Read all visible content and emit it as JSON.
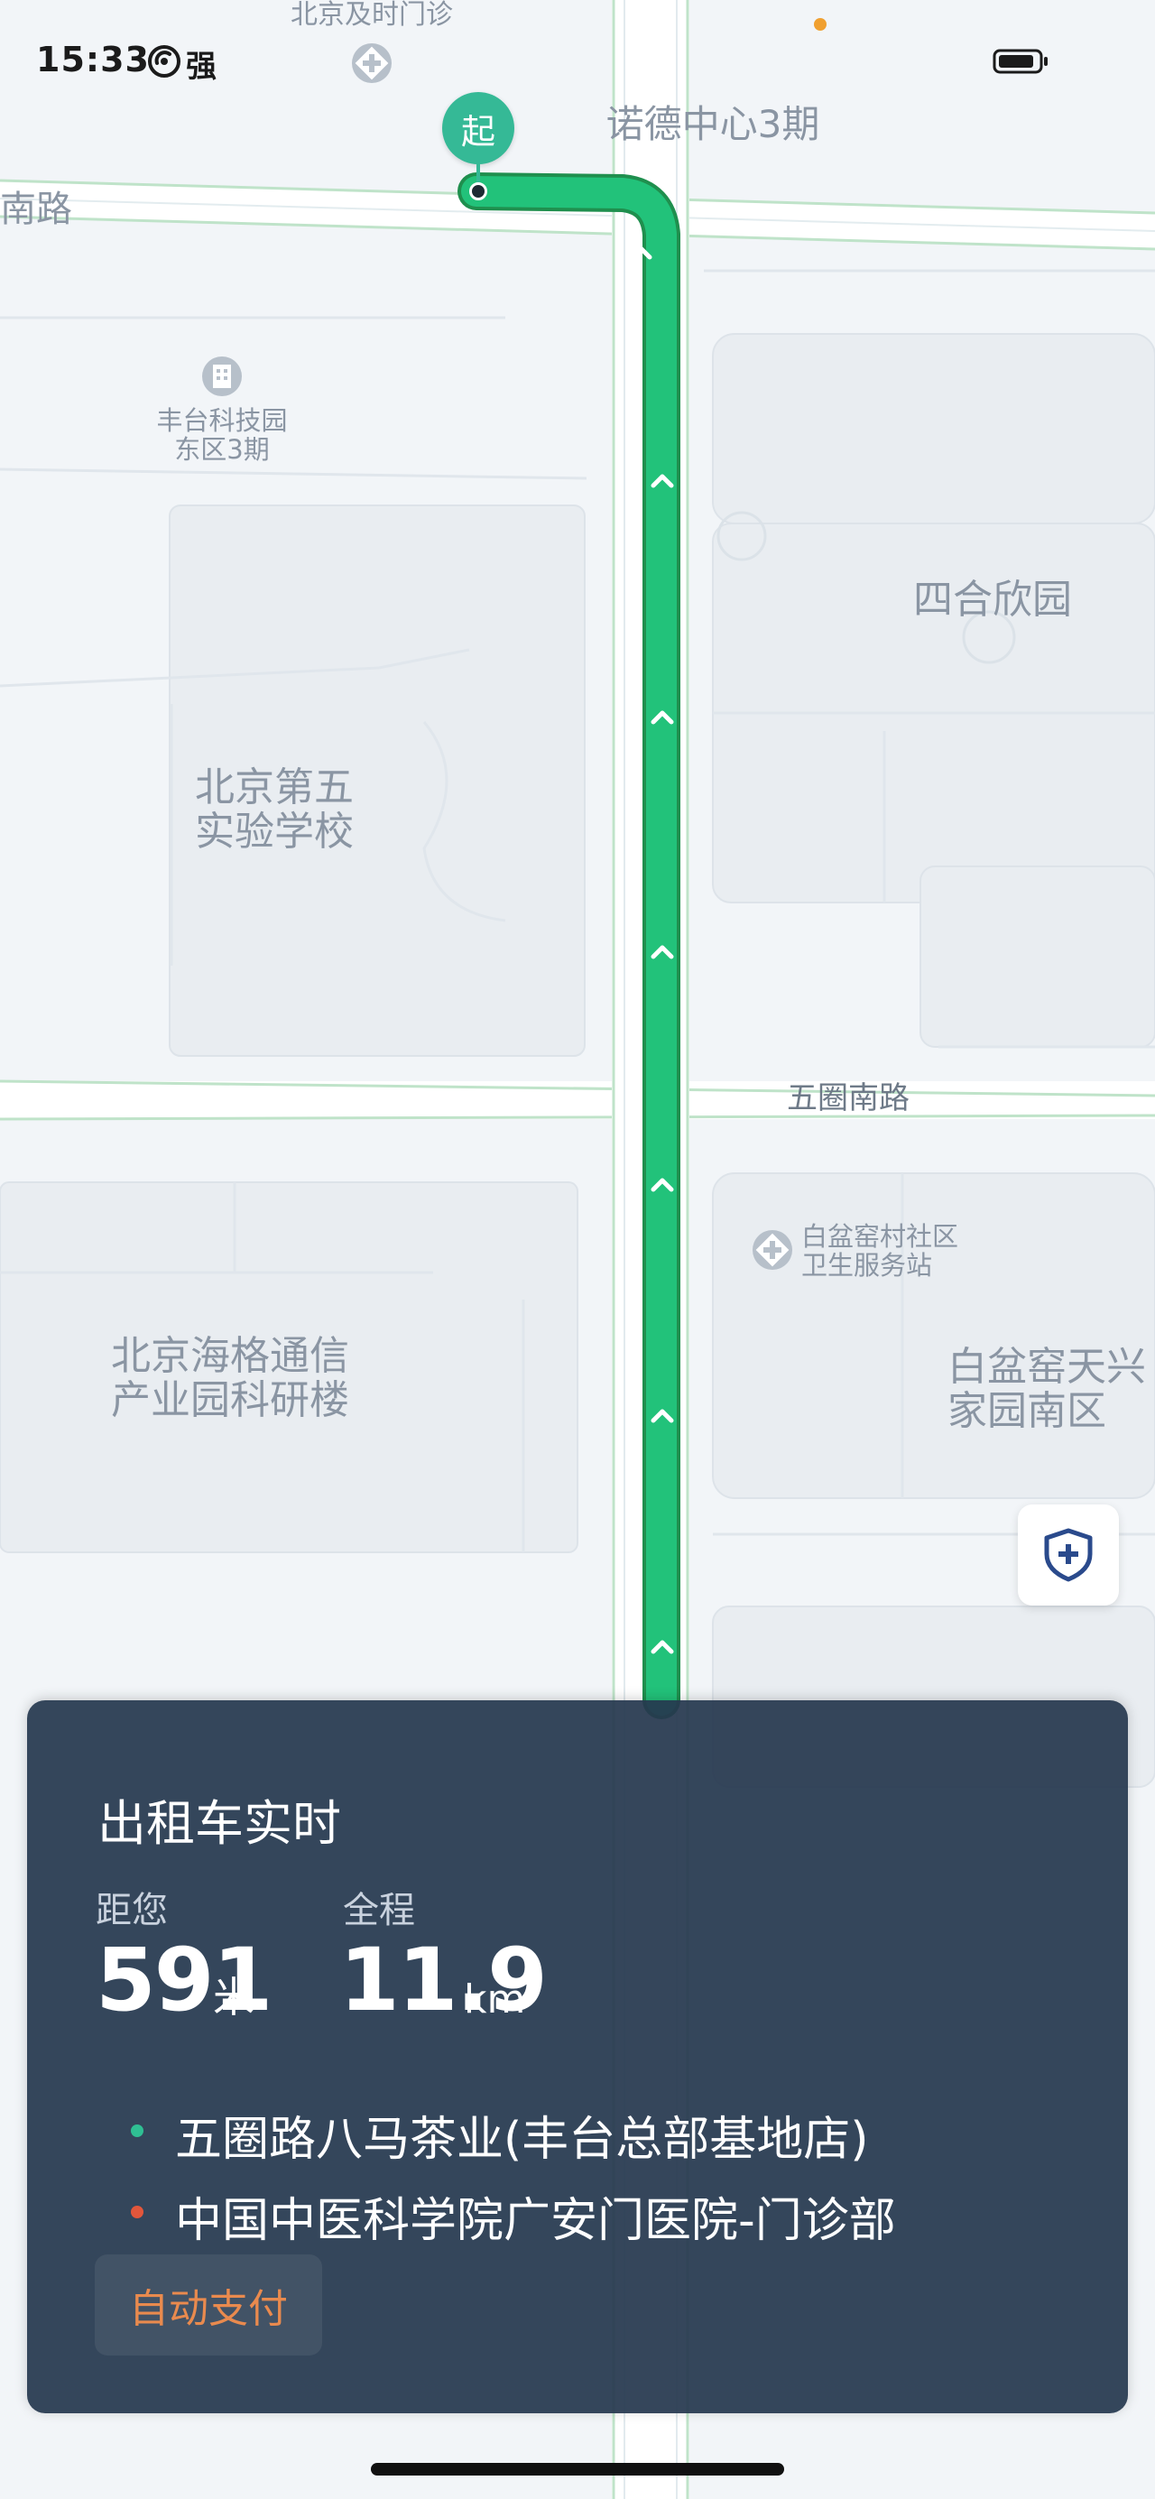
{
  "status_bar": {
    "time": "15:33",
    "signal_label": "强"
  },
  "map": {
    "labels": {
      "top_clinic": "北京及时门诊",
      "nuode": "诺德中心3期",
      "nanlu": "南路",
      "fengtai": "丰台科技园\n东区3期",
      "siheyuan": "四合欣园",
      "school": "北京第五\n实验学校",
      "wuquan": "五圈南路",
      "baipen_clinic": "白盆窑村社区\n卫生服务站",
      "haige": "北京海格通信\n产业园科研楼",
      "tianxing": "白盆窑天兴\n家园南区"
    },
    "start_marker_label": "起",
    "route_color": "#22c27a",
    "route_outline_color": "#1f8f4e"
  },
  "trip_card": {
    "title": "出租车实时",
    "distance_to_you": {
      "label": "距您",
      "value": "591",
      "unit": "米"
    },
    "total_distance": {
      "label": "全程",
      "value": "11.9",
      "unit": "km"
    },
    "pickup": {
      "text": "五圈路八马茶业(丰台总部基地店)",
      "dot_color": "#2fbf93"
    },
    "destination": {
      "text": "中国中医科学院广安门医院-门诊部",
      "dot_color": "#e2563b"
    },
    "payment_badge": "自动支付",
    "card_color": "#26384f",
    "badge_color": "#e98a4e"
  },
  "icons": {
    "safety": "shield-plus-icon",
    "clinic": "hospital-diamond-icon",
    "building": "office-building-icon",
    "signal": "signal-arc-icon",
    "battery": "battery-icon"
  }
}
